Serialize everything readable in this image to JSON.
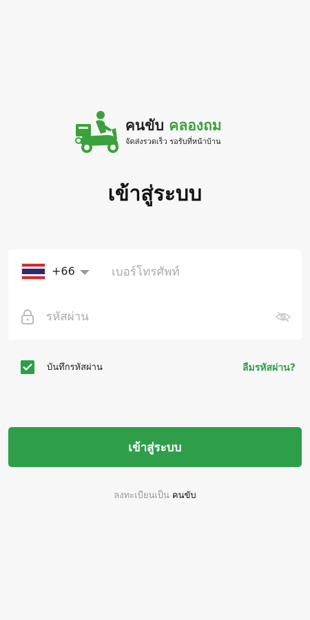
{
  "brand": {
    "name_part1": "คนขับ",
    "name_part2": "คลองถม",
    "tagline": "จัดส่งรวดเร็ว รอรับที่หน้าบ้าน",
    "accent_color": "#3aa23a"
  },
  "page_title": "เข้าสู่ระบบ",
  "form": {
    "country_flag": "thailand-flag",
    "dial_code": "+66",
    "phone_placeholder": "เบอร์โทรศัพท์",
    "phone_value": "",
    "password_placeholder": "รหัสผ่าน",
    "password_value": ""
  },
  "remember": {
    "label": "บันทึกรหัสผ่าน",
    "checked": true
  },
  "forgot_password": "ลืมรหัสผ่าน?",
  "login_button": "เข้าสู่ระบบ",
  "register": {
    "prompt": "ลงทะเบียนเป็น",
    "link": "คนขับ"
  },
  "colors": {
    "primary": "#2e9e4a",
    "background": "#f7f7f7"
  }
}
